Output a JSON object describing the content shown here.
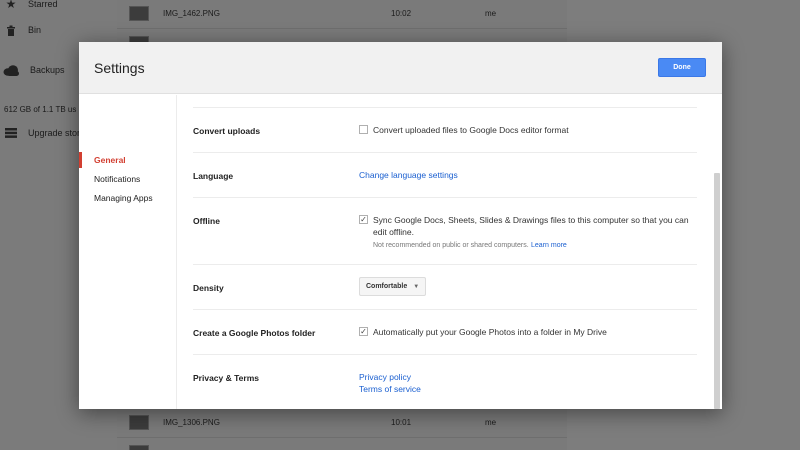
{
  "sidebar": {
    "items": [
      {
        "label": "Starred",
        "icon": "star-icon"
      },
      {
        "label": "Bin",
        "icon": "bin-icon"
      },
      {
        "label": "Backups",
        "icon": "cloud-icon"
      }
    ],
    "storage_text": "612 GB of 1.1 TB us",
    "upgrade_label": "Upgrade stora"
  },
  "file_list": {
    "rows": [
      {
        "name": "IMG_1462.PNG",
        "time": "10:02",
        "owner": "me"
      },
      {
        "name": "IMG_1306.PNG",
        "time": "10:01",
        "owner": "me"
      }
    ]
  },
  "dialog": {
    "title": "Settings",
    "done_label": "Done",
    "nav": [
      {
        "label": "General",
        "active": true
      },
      {
        "label": "Notifications",
        "active": false
      },
      {
        "label": "Managing Apps",
        "active": false
      }
    ],
    "general": {
      "convert_uploads": {
        "label": "Convert uploads",
        "checkbox_label": "Convert uploaded files to Google Docs editor format",
        "checked": false
      },
      "language": {
        "label": "Language",
        "link": "Change language settings"
      },
      "offline": {
        "label": "Offline",
        "checkbox_label_line1": "Sync Google Docs, Sheets, Slides & Drawings files to this computer so that you can",
        "checkbox_label_line2": "edit offline.",
        "note": "Not recommended on public or shared computers.",
        "note_link": "Learn more",
        "checked": true
      },
      "density": {
        "label": "Density",
        "selected": "Comfortable"
      },
      "photos_folder": {
        "label": "Create a Google Photos folder",
        "checkbox_label": "Automatically put your Google Photos into a folder in My Drive",
        "checked": true
      },
      "privacy": {
        "label": "Privacy & Terms",
        "privacy_link": "Privacy policy",
        "terms_link": "Terms of service"
      }
    }
  },
  "colors": {
    "accent_blue": "#4a8af4",
    "link_blue": "#1a5fd0",
    "active_red": "#d23f31"
  }
}
